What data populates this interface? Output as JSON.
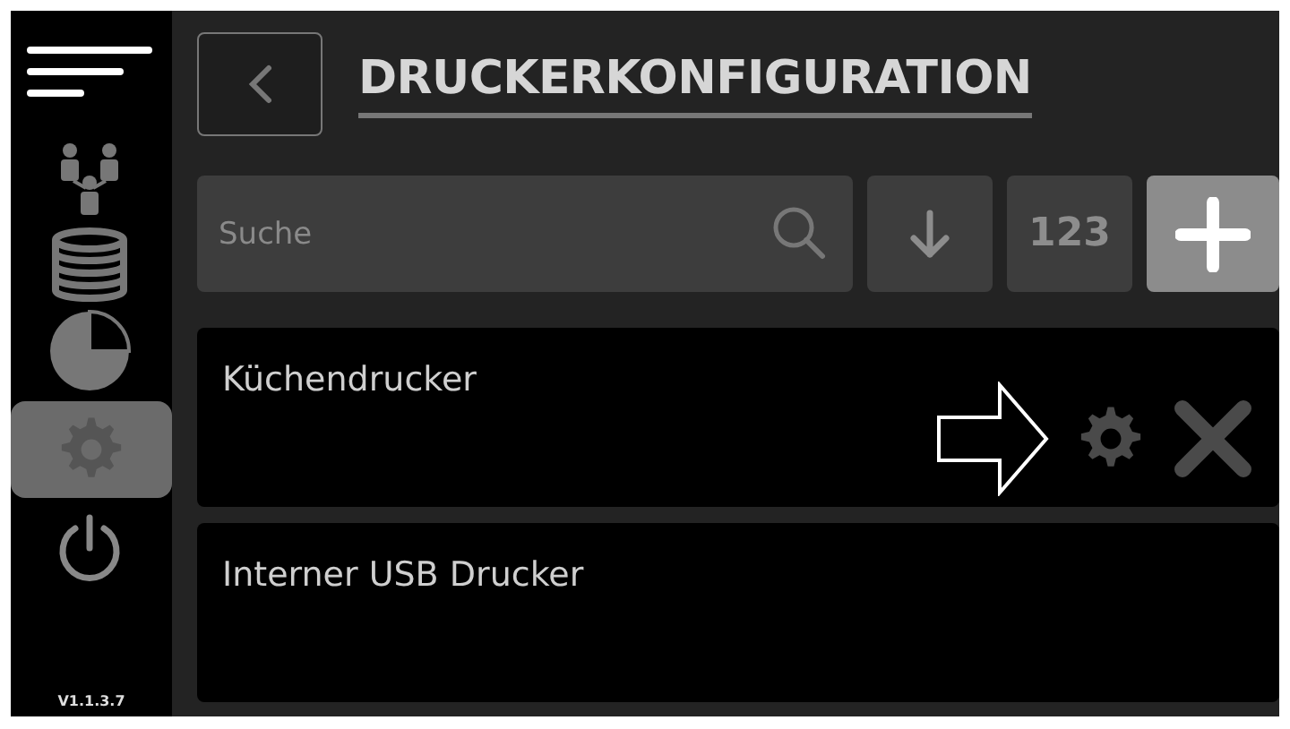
{
  "sidebar": {
    "items": [
      {
        "kind": "menu",
        "selected": false
      },
      {
        "kind": "users",
        "selected": false
      },
      {
        "kind": "database",
        "selected": false
      },
      {
        "kind": "chart",
        "selected": false
      },
      {
        "kind": "settings",
        "selected": true
      },
      {
        "kind": "power",
        "selected": false
      }
    ],
    "version": "V1.1.3.7"
  },
  "header": {
    "title": "DRUCKERKONFIGURATION"
  },
  "search": {
    "placeholder": "Suche"
  },
  "toolbar": [
    {
      "kind": "sort"
    },
    {
      "kind": "number",
      "label": "123"
    },
    {
      "kind": "add"
    }
  ],
  "printers": [
    {
      "name": "Küchendrucker",
      "selected": true
    },
    {
      "name": "Interner USB Drucker",
      "selected": false
    }
  ]
}
